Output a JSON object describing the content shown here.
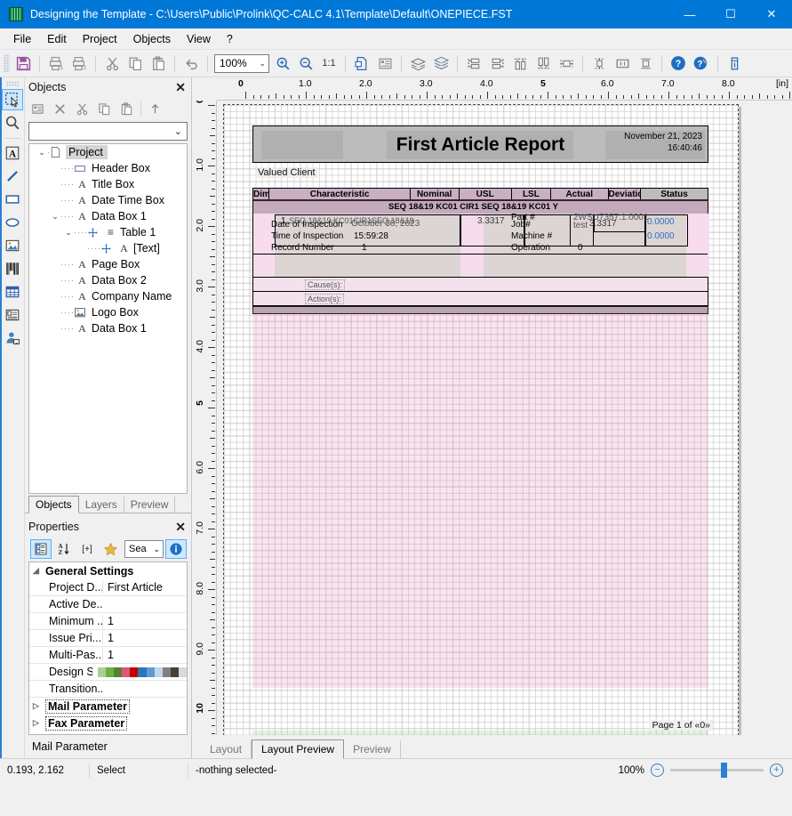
{
  "window": {
    "title": "Designing the Template - C:\\Users\\Public\\Prolink\\QC-CALC 4.1\\Template\\Default\\ONEPIECE.FST",
    "minimize": "—",
    "maximize": "☐",
    "close": "✕"
  },
  "menubar": {
    "items": [
      "File",
      "Edit",
      "Project",
      "Objects",
      "View",
      "?"
    ]
  },
  "toolbar": {
    "zoom_value": "100%",
    "zoom_chevron": "⌄",
    "ratio_label": "1:1",
    "icons": [
      "save-icon",
      "print-icon",
      "print-preview-icon",
      "cut-icon",
      "copy-icon",
      "paste-icon",
      "undo-icon",
      "zoom-in-icon",
      "zoom-out-icon",
      "zoom-reset-icon",
      "new-page-icon",
      "object-list-icon",
      "bring-to-front-icon",
      "send-to-back-icon",
      "align-left-icon",
      "align-right-icon",
      "align-top-icon",
      "align-bottom-icon",
      "center-horizontal-icon",
      "center-vertical-icon",
      "same-width-icon",
      "same-height-icon",
      "help-icon",
      "context-help-icon",
      "info-icon"
    ]
  },
  "toolstrip": {
    "items": [
      {
        "name": "select-tool",
        "selected": true
      },
      {
        "name": "zoom-tool",
        "selected": false
      },
      {
        "name": "text-object-tool",
        "selected": false
      },
      {
        "name": "line-object-tool",
        "selected": false
      },
      {
        "name": "rectangle-object-tool",
        "selected": false
      },
      {
        "name": "ellipse-object-tool",
        "selected": false
      },
      {
        "name": "picture-object-tool",
        "selected": false
      },
      {
        "name": "barcode-object-tool",
        "selected": false
      },
      {
        "name": "table-object-tool",
        "selected": false
      },
      {
        "name": "form-control-tool",
        "selected": false
      },
      {
        "name": "report-container-tool",
        "selected": false
      }
    ]
  },
  "objects_panel": {
    "title": "Objects",
    "close_label": "✕",
    "mini_toolbar": [
      "properties-icon",
      "delete-icon",
      "cut-icon",
      "copy-icon",
      "paste-icon",
      "move-up-icon"
    ],
    "filter_value": "",
    "tree": [
      {
        "label": "Project",
        "icon": "page-icon",
        "depth": 0,
        "expander": "⌄",
        "selected": true
      },
      {
        "label": "Header Box",
        "icon": "box-icon",
        "depth": 1,
        "expander": "",
        "selected": false
      },
      {
        "label": "Title Box",
        "icon": "text-icon",
        "depth": 1,
        "expander": "",
        "selected": false
      },
      {
        "label": "Date Time Box",
        "icon": "text-icon",
        "depth": 1,
        "expander": "",
        "selected": false
      },
      {
        "label": "Data Box 1",
        "icon": "text-icon",
        "depth": 1,
        "expander": "⌄",
        "selected": false
      },
      {
        "label": "Table 1",
        "icon": "table-icon",
        "depth": 2,
        "expander": "⌄",
        "selected": false
      },
      {
        "label": "[Text]",
        "icon": "text-icon",
        "depth": 3,
        "expander": "",
        "selected": false
      },
      {
        "label": "Page Box",
        "icon": "text-icon",
        "depth": 1,
        "expander": "",
        "selected": false
      },
      {
        "label": "Data Box 2",
        "icon": "text-icon",
        "depth": 1,
        "expander": "",
        "selected": false
      },
      {
        "label": "Company Name",
        "icon": "text-icon",
        "depth": 1,
        "expander": "",
        "selected": false
      },
      {
        "label": "Logo Box",
        "icon": "picture-icon",
        "depth": 1,
        "expander": "",
        "selected": false
      },
      {
        "label": "Data Box 1",
        "icon": "text-icon",
        "depth": 1,
        "expander": "",
        "selected": false
      }
    ],
    "tabs": [
      {
        "label": "Objects",
        "active": true
      },
      {
        "label": "Layers",
        "active": false
      },
      {
        "label": "Preview",
        "active": false
      }
    ]
  },
  "properties_panel": {
    "title": "Properties",
    "close_label": "✕",
    "toolbar": {
      "categorized": "categorized-view-icon",
      "alpha": "alphabetical-sort-icon",
      "expand": "[+]",
      "favorites": "star-icon",
      "search_value": "Sea",
      "search_chevron": "⌄",
      "info": "info-icon"
    },
    "groups": [
      {
        "name": "General Settings",
        "triangle": "◢",
        "rows": [
          {
            "key": "Project D...",
            "value": "First Article"
          },
          {
            "key": "Active De...",
            "value": ""
          },
          {
            "key": "Minimum ...",
            "value": "1"
          },
          {
            "key": "Issue Pri...",
            "value": "1"
          },
          {
            "key": "Multi-Pas...",
            "value": "1"
          },
          {
            "key": "Design S...",
            "value": "",
            "swatches": [
              "#a9d18e",
              "#70ad47",
              "#548235",
              "#e15575",
              "#c00000",
              "#2e75b6",
              "#5b9bd5",
              "#bdd7ee",
              "#808080",
              "#404040",
              "#d9d9d9"
            ]
          },
          {
            "key": "Transition...",
            "value": ""
          }
        ]
      },
      {
        "name": "Mail Parameter",
        "triangle": "▷",
        "rows": []
      },
      {
        "name": "Fax Parameter",
        "triangle": "▷",
        "rows": []
      }
    ],
    "footer_label": "Mail Parameter"
  },
  "rulers": {
    "h_unit": "[in]",
    "h_labels": [
      "0",
      "1.0",
      "2.0",
      "3.0",
      "4.0",
      "5",
      "6.0",
      "7.0",
      "8.0"
    ],
    "v_unit": "[in]",
    "v_labels": [
      "0",
      "1.0",
      "2.0",
      "3.0",
      "4.0",
      "5",
      "6.0",
      "7.0",
      "8.0",
      "9.0",
      "10"
    ]
  },
  "document": {
    "report_title": "First Article Report",
    "date": "November 21, 2023",
    "time": "16:40:46",
    "client": "Valued Client",
    "table_headers": [
      "Dim",
      "Characteristic",
      "Nominal",
      "USL",
      "LSL",
      "Actual",
      "Deviation",
      "Status"
    ],
    "sub_header": "SEQ  18&19  KC01 CIR1 SEQ   18&19  KC01 Y",
    "overlay_fields": [
      {
        "label": "Date of Inspection",
        "value": "October 30, 2023"
      },
      {
        "label": "Time of Inspection",
        "value": "15:59:28"
      },
      {
        "label": "Record Number",
        "value": "1"
      },
      {
        "label": "Part #",
        "value": "2WSU7357.1.0001"
      },
      {
        "label": "Job#",
        "value": "test"
      },
      {
        "label": "Machine #",
        "value": ""
      },
      {
        "label": "Operation",
        "value": "0"
      }
    ],
    "data_row": {
      "dim": "1",
      "characteristic": "SEQ  18&19  KC01CIR1SEQ  18&19",
      "nominal": "3.3317",
      "actual": "3.3317",
      "deviation_1": "0.0000",
      "deviation_2": "0.0000"
    },
    "cause_label": "Cause(s):",
    "action_label": "Action(s):",
    "page_footer": "Page 1 of  «0»"
  },
  "bottom_tabs": [
    {
      "label": "Layout",
      "active": false
    },
    {
      "label": "Layout Preview",
      "active": true
    },
    {
      "label": "Preview",
      "active": false
    }
  ],
  "statusbar": {
    "coords": "0.193, 2.162",
    "mode": "Select",
    "selection": "-nothing selected-",
    "zoom": "100%",
    "zoom_out": "−",
    "zoom_in": "+"
  }
}
